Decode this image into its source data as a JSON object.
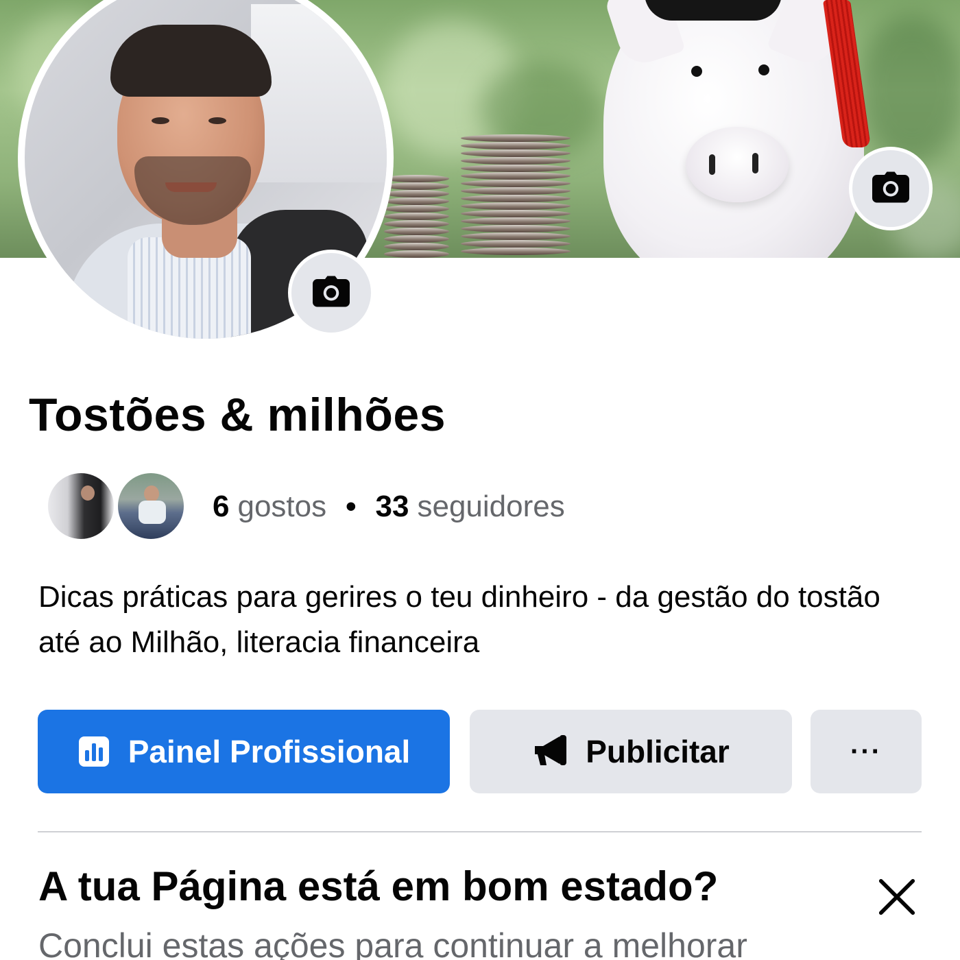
{
  "page": {
    "name": "Tostões & milhões",
    "likes_count": "6",
    "likes_label": "gostos",
    "separator": "•",
    "followers_count": "33",
    "followers_label": "seguidores",
    "description": "Dicas práticas para gerires o teu dinheiro - da gestão do tostão até ao Milhão,  literacia financeira"
  },
  "actions": {
    "professional_dashboard": "Painel Profissional",
    "advertise": "Publicitar",
    "more": "···"
  },
  "health_card": {
    "title": "A tua Página está em bom estado?",
    "subtitle": "Conclui estas ações para continuar a melhorar"
  },
  "icons": {
    "cover_camera": "camera-icon",
    "avatar_camera": "camera-icon",
    "dashboard": "bar-chart-icon",
    "advertise": "megaphone-icon",
    "close": "close-icon"
  },
  "colors": {
    "primary": "#1b74e4",
    "secondary_bg": "#e4e6eb",
    "text": "#050505",
    "muted_text": "#65676b"
  }
}
